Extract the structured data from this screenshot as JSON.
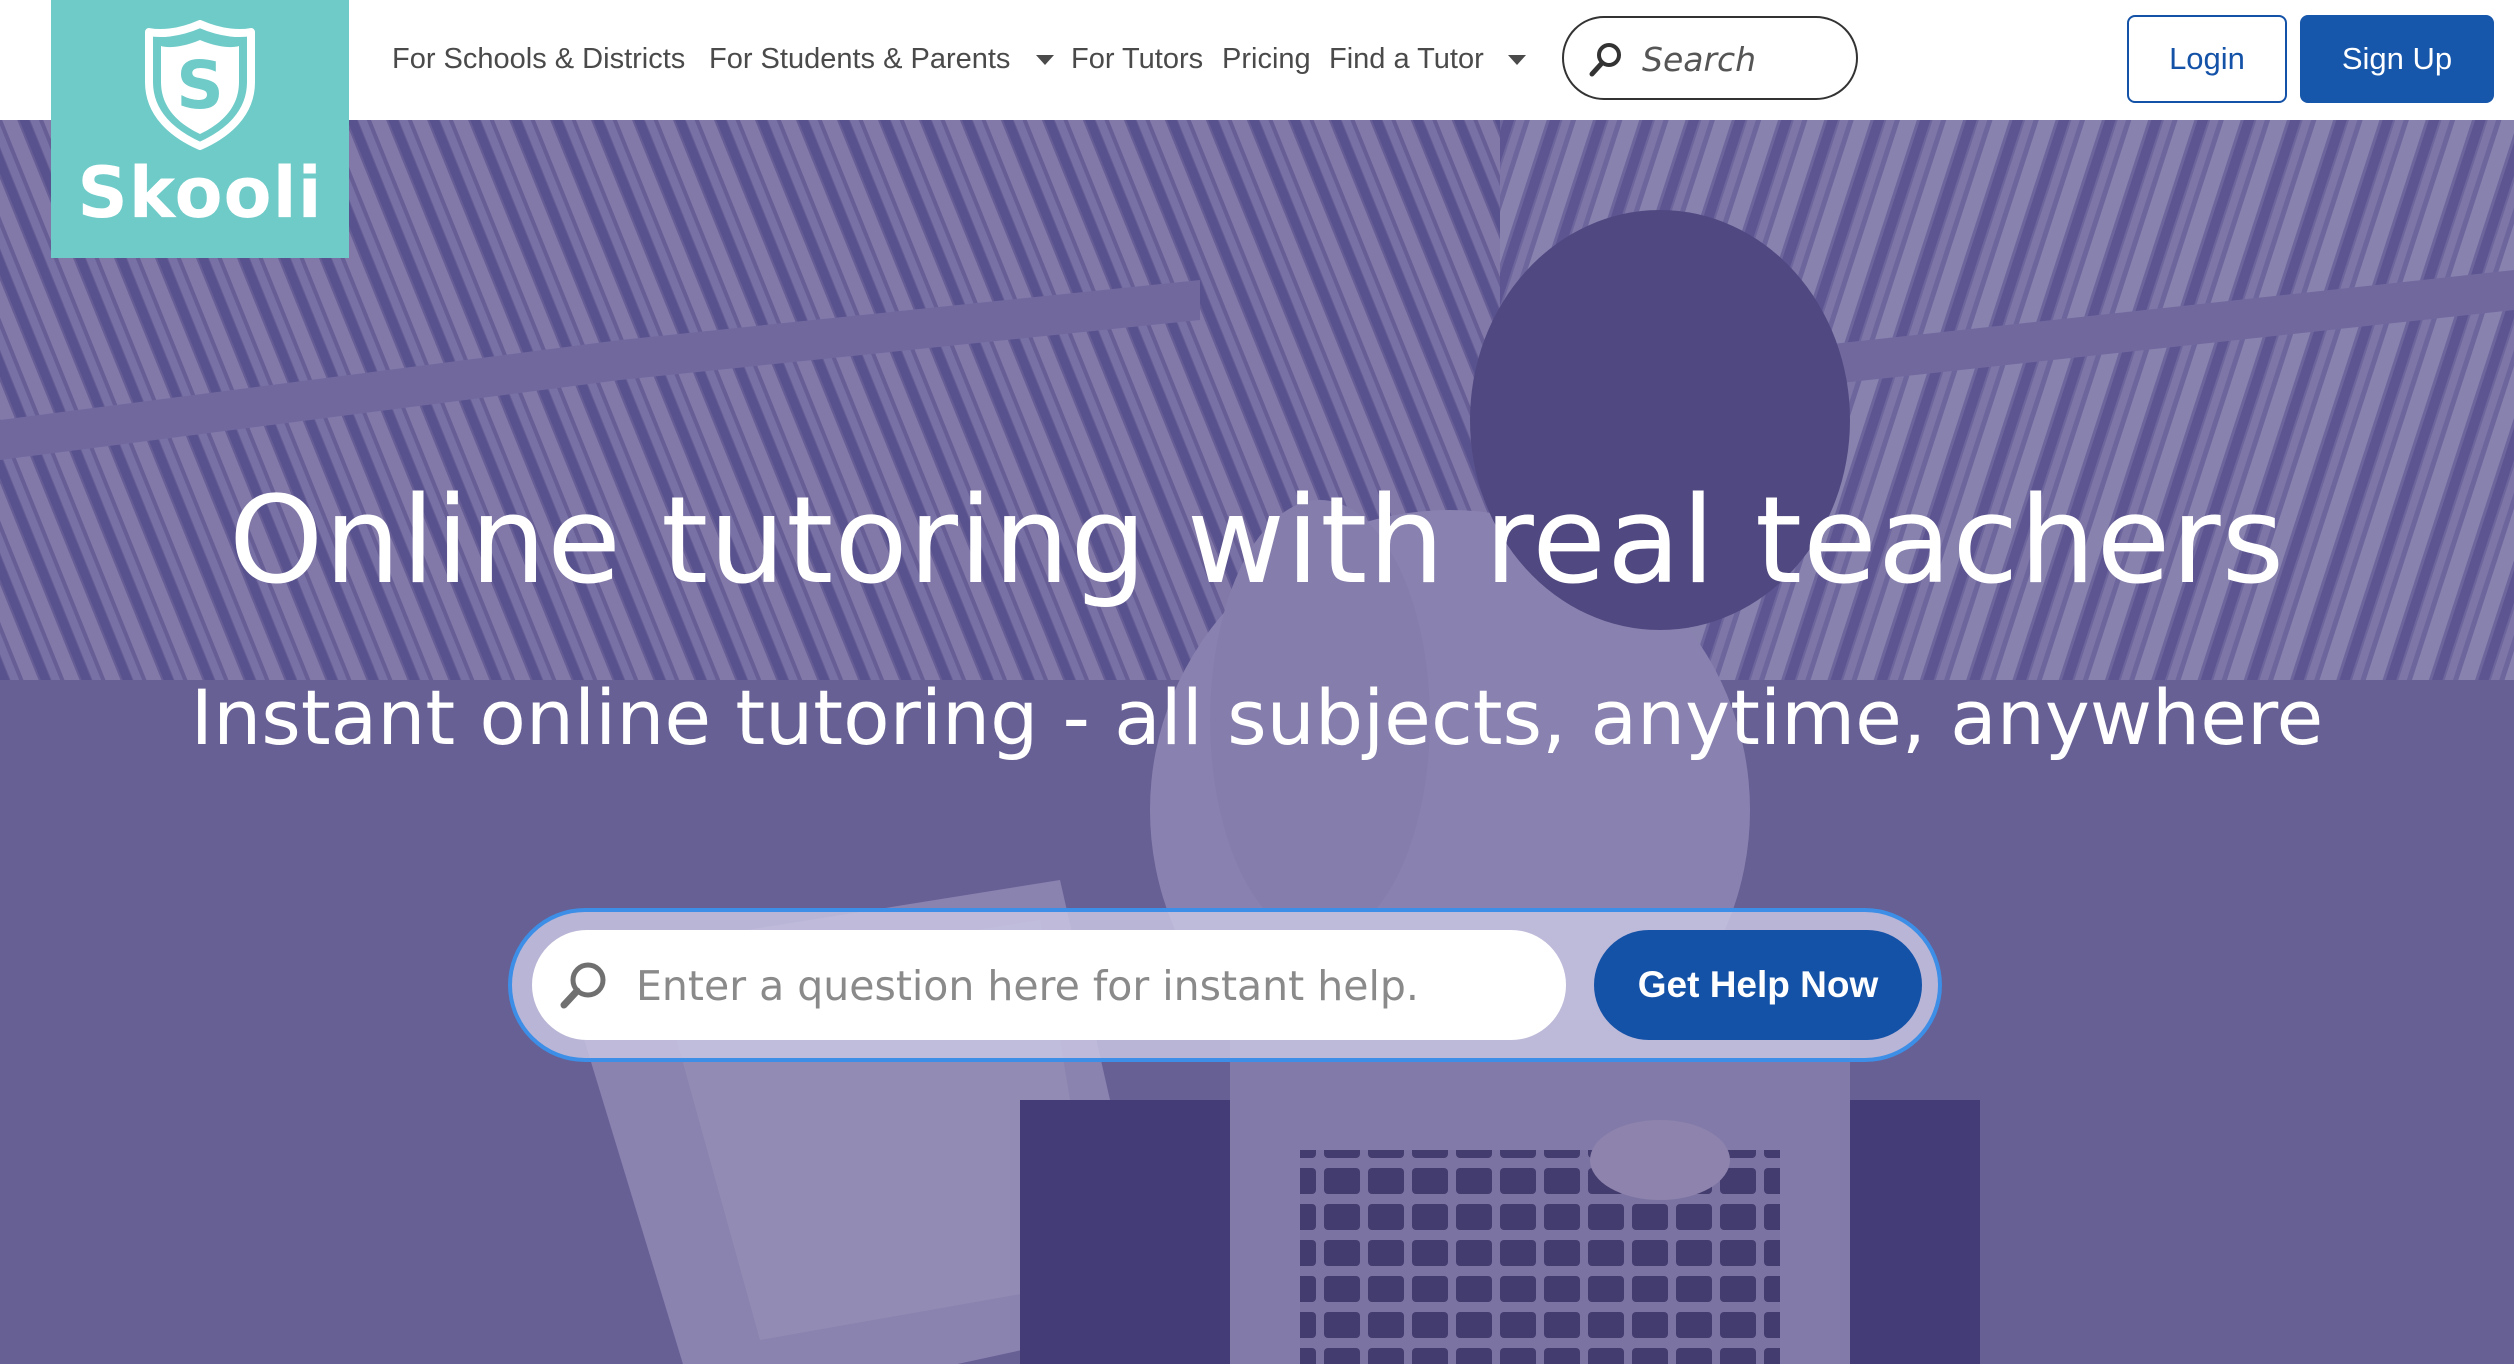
{
  "brand": {
    "name": "Skooli",
    "shield_letter": "S",
    "logo_color": "#6ecbc8"
  },
  "nav": {
    "items": [
      {
        "label": "For Schools & Districts",
        "dropdown": false
      },
      {
        "label": "For Students & Parents",
        "dropdown": true
      },
      {
        "label": "For Tutors",
        "dropdown": false
      },
      {
        "label": "Pricing",
        "dropdown": false
      },
      {
        "label": "Find a Tutor",
        "dropdown": true
      }
    ],
    "search_placeholder": "Search",
    "search_icon": "search-icon"
  },
  "auth": {
    "login_label": "Login",
    "signup_label": "Sign Up",
    "primary_color": "#1452a8"
  },
  "hero": {
    "headline": "Online tutoring with real teachers",
    "subheadline": "Instant online tutoring - all subjects, anytime, anywhere",
    "question_placeholder": "Enter a question here for instant help.",
    "cta_label": "Get Help Now",
    "overlay_color": "#483e80"
  }
}
